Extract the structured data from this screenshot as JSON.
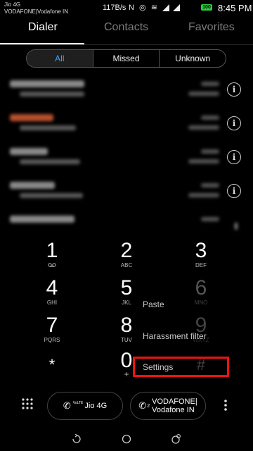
{
  "status_bar": {
    "carrier_line1": "Jio 4G",
    "carrier_line2": "VODAFONE|Vodafone IN",
    "speed": "117B/s",
    "battery": "100",
    "time": "8:45 PM"
  },
  "tabs": [
    {
      "label": "Dialer",
      "active": true
    },
    {
      "label": "Contacts",
      "active": false
    },
    {
      "label": "Favorites",
      "active": false
    }
  ],
  "filters": [
    "All",
    "Missed",
    "Unknown"
  ],
  "keypad": [
    {
      "digit": "1",
      "letters": "voicemail-icon"
    },
    {
      "digit": "2",
      "letters": "ABC"
    },
    {
      "digit": "3",
      "letters": "DEF"
    },
    {
      "digit": "4",
      "letters": "GHI"
    },
    {
      "digit": "5",
      "letters": "JKL"
    },
    {
      "digit": "6",
      "letters": "MNO"
    },
    {
      "digit": "7",
      "letters": "PQRS"
    },
    {
      "digit": "8",
      "letters": "TUV"
    },
    {
      "digit": "9",
      "letters": "WXYZ"
    },
    {
      "digit": "*",
      "letters": ""
    },
    {
      "digit": "0",
      "letters": "+"
    },
    {
      "digit": "#",
      "letters": ""
    }
  ],
  "context_menu": {
    "items": [
      "Paste",
      "Harassment filter",
      "Settings"
    ]
  },
  "sim_buttons": [
    {
      "tag": "VoLTE",
      "label": "Jio 4G"
    },
    {
      "slot": "2",
      "label_line1": "VODAFONE|",
      "label_line2": "Vodafone IN"
    }
  ],
  "colors": {
    "accent": "#3aa0ff",
    "highlight": "#ee1111",
    "battery": "#2ecc40"
  }
}
